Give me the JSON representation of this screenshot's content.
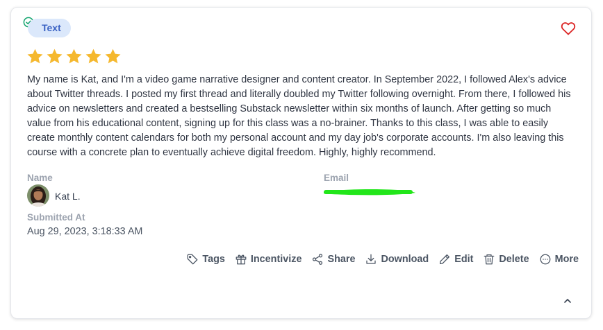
{
  "card": {
    "type_badge": "Text",
    "status_icon": "check-circle-icon",
    "favorite_icon": "heart-outline-icon",
    "rating": 5,
    "rating_max": 5,
    "review_text": "My name is Kat, and I'm a video game narrative designer and content creator. In September 2022, I followed Alex's advice about Twitter threads. I posted my first thread and literally doubled my Twitter following overnight. From there, I followed his advice on newsletters and created a bestselling Substack newsletter within six months of launch. After getting so much value from his educational content, signing up for this class was a no-brainer. Thanks to this class, I was able to easily create monthly content calendars for both my personal account and my day job's corporate accounts. I'm also leaving this course with a concrete plan to eventually achieve digital freedom. Highly, highly recommend."
  },
  "fields": {
    "name_label": "Name",
    "name_value": "Kat L.",
    "email_label": "Email",
    "email_value_redacted": true,
    "submitted_label": "Submitted At",
    "submitted_value": "Aug 29, 2023, 3:18:33 AM"
  },
  "actions": [
    {
      "label": "Tags",
      "icon": "tag-icon"
    },
    {
      "label": "Incentivize",
      "icon": "gift-icon"
    },
    {
      "label": "Share",
      "icon": "share-icon"
    },
    {
      "label": "Download",
      "icon": "download-icon"
    },
    {
      "label": "Edit",
      "icon": "pencil-icon"
    },
    {
      "label": "Delete",
      "icon": "trash-icon"
    },
    {
      "label": "More",
      "icon": "more-circle-icon"
    }
  ],
  "colors": {
    "star": "#f5b82e",
    "heart": "#dc2626",
    "badge_bg": "#dbe8fb",
    "badge_text": "#3b63c4",
    "check": "#10a36d",
    "redaction": "#22e61a"
  }
}
